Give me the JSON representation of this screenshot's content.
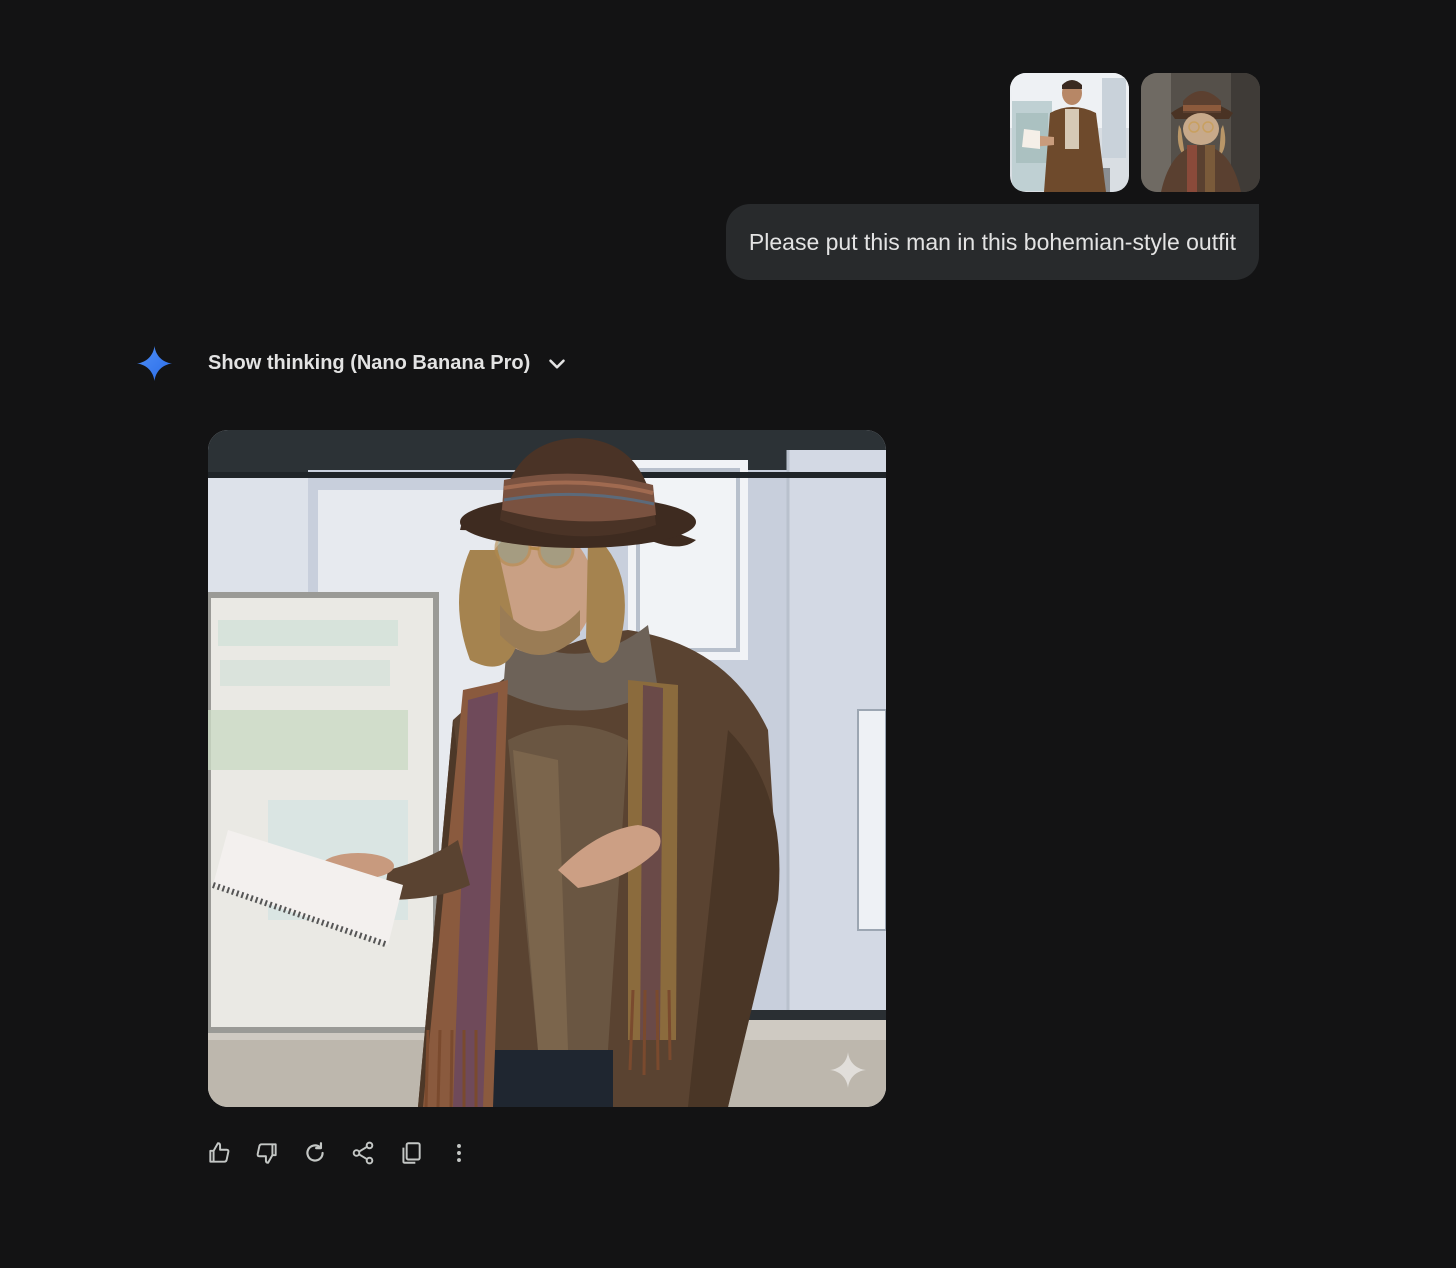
{
  "user_turn": {
    "attachments": [
      {
        "icon": "person-photo-thumbnail",
        "description_name": "man-in-brown-jacket-photo"
      },
      {
        "icon": "person-photo-thumbnail",
        "description_name": "bohemian-outfit-photo"
      }
    ],
    "prompt_text": "Please put this man in this bohemian-style outfit"
  },
  "model_turn": {
    "icon": "gemini-spark-icon",
    "thinking_label": "Show thinking (Nano Banana Pro)",
    "thinking_expanded": false,
    "image": {
      "icon": "generated-image",
      "watermark": "gemini-sparkle-watermark"
    },
    "actions": [
      {
        "name": "thumbs-up",
        "icon": "thumbs-up-icon"
      },
      {
        "name": "thumbs-down",
        "icon": "thumbs-down-icon"
      },
      {
        "name": "regenerate",
        "icon": "refresh-icon"
      },
      {
        "name": "share",
        "icon": "share-icon"
      },
      {
        "name": "copy",
        "icon": "copy-icon"
      },
      {
        "name": "more",
        "icon": "more-vert-icon"
      }
    ]
  },
  "colors": {
    "background": "#131314",
    "bubble": "#282a2c",
    "text": "#e3e3e3",
    "accent_blue": "#4285f4"
  }
}
